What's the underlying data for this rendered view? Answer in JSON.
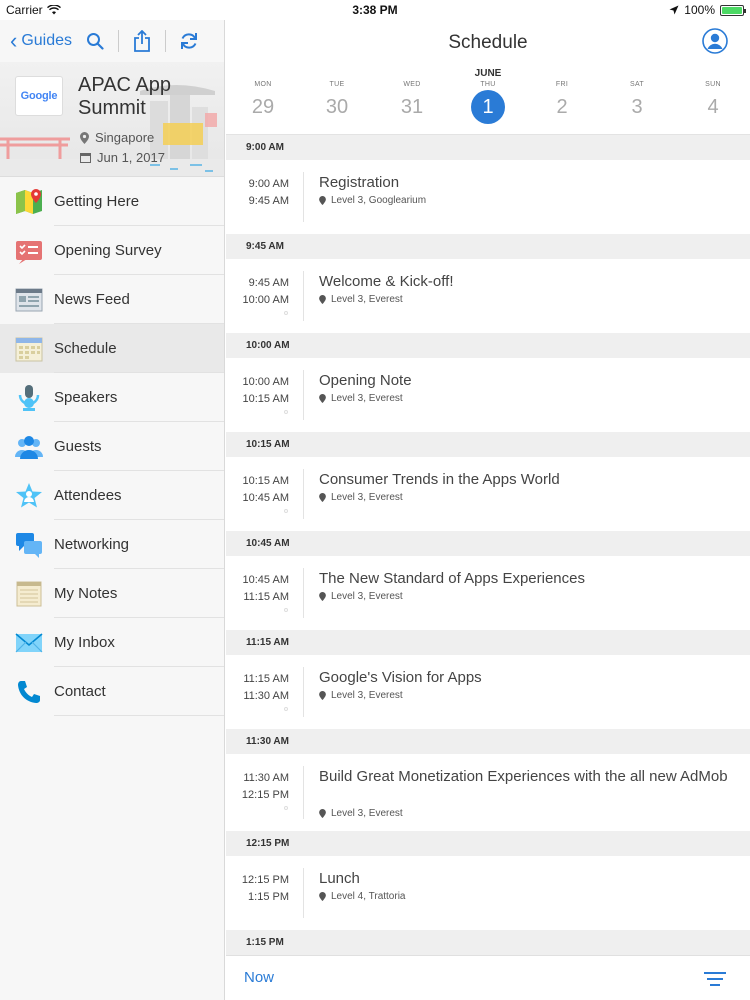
{
  "status_bar": {
    "carrier": "Carrier",
    "time": "3:38 PM",
    "battery": "100%"
  },
  "sidebar": {
    "back_label": "Guides",
    "guide": {
      "logo_text": "Google",
      "title": "APAC App Summit",
      "location": "Singapore",
      "date": "Jun 1, 2017"
    },
    "items": [
      {
        "label": "Getting Here",
        "icon": "map-icon"
      },
      {
        "label": "Opening Survey",
        "icon": "checklist-icon"
      },
      {
        "label": "News Feed",
        "icon": "newspaper-icon"
      },
      {
        "label": "Schedule",
        "icon": "calendar-icon",
        "active": true
      },
      {
        "label": "Speakers",
        "icon": "microphone-icon"
      },
      {
        "label": "Guests",
        "icon": "group-icon"
      },
      {
        "label": "Attendees",
        "icon": "star-person-icon"
      },
      {
        "label": "Networking",
        "icon": "chat-bubbles-icon"
      },
      {
        "label": "My Notes",
        "icon": "notepad-icon"
      },
      {
        "label": "My Inbox",
        "icon": "envelope-icon"
      },
      {
        "label": "Contact",
        "icon": "phone-icon"
      }
    ]
  },
  "main": {
    "title": "Schedule",
    "month": "JUNE",
    "days": [
      {
        "dow": "MON",
        "num": "29"
      },
      {
        "dow": "TUE",
        "num": "30"
      },
      {
        "dow": "WED",
        "num": "31"
      },
      {
        "dow": "THU",
        "num": "1",
        "selected": true
      },
      {
        "dow": "FRI",
        "num": "2"
      },
      {
        "dow": "SAT",
        "num": "3"
      },
      {
        "dow": "SUN",
        "num": "4"
      }
    ],
    "sections": [
      {
        "header": "9:00 AM",
        "start": "9:00 AM",
        "end": "9:45 AM",
        "title": "Registration",
        "location": "Level 3, Googlearium"
      },
      {
        "header": "9:45 AM",
        "start": "9:45 AM",
        "end": "10:00 AM",
        "title": "Welcome & Kick-off!",
        "location": "Level 3, Everest"
      },
      {
        "header": "10:00 AM",
        "start": "10:00 AM",
        "end": "10:15 AM",
        "title": "Opening Note",
        "location": "Level 3, Everest"
      },
      {
        "header": "10:15 AM",
        "start": "10:15 AM",
        "end": "10:45 AM",
        "title": "Consumer Trends in the Apps World",
        "location": "Level 3, Everest"
      },
      {
        "header": "10:45 AM",
        "start": "10:45 AM",
        "end": "11:15 AM",
        "title": "The New Standard of Apps Experiences",
        "location": "Level 3, Everest"
      },
      {
        "header": "11:15 AM",
        "start": "11:15 AM",
        "end": "11:30 AM",
        "title": "Google's Vision for Apps",
        "location": "Level 3, Everest"
      },
      {
        "header": "11:30 AM",
        "start": "11:30 AM",
        "end": "12:15 PM",
        "title": "Build Great Monetization Experiences with the all new AdMob",
        "location": "Level 3, Everest",
        "tall": true
      },
      {
        "header": "12:15 PM",
        "start": "12:15 PM",
        "end": "1:15 PM",
        "title": "Lunch",
        "location": "Level 4, Trattoria"
      },
      {
        "header": "1:15 PM",
        "start": "",
        "end": "",
        "title": "",
        "location": ""
      }
    ],
    "footer": {
      "now_label": "Now",
      "filter_icon": "filter-icon"
    }
  },
  "colors": {
    "accent": "#2a7bd6",
    "section_bg": "#efefef"
  }
}
